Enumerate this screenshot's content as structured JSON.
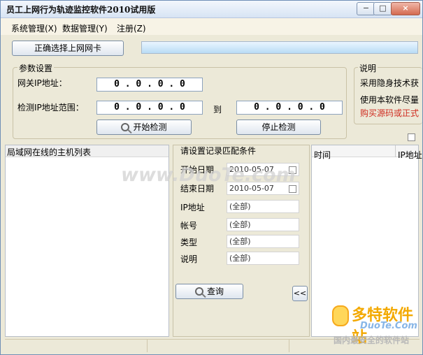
{
  "window": {
    "title": "员工上网行为轨迹监控软件2010试用版",
    "minimize": "−",
    "maximize": "□",
    "close": "×"
  },
  "menu": {
    "system": "系统管理(X)",
    "data": "数据管理(Y)",
    "register": "注册(Z)"
  },
  "toolbar": {
    "select_nic": "正确选择上网网卡"
  },
  "params": {
    "title": "参数设置",
    "gateway_label": "网关IP地址：",
    "gateway_ip": "0 . 0 . 0 . 0",
    "range_label": "检测IP地址范围：",
    "range_start": "0 . 0 . 0 . 0",
    "to_label": "到",
    "range_end": "0 . 0 . 0 . 0",
    "start_button": "开始检测",
    "stop_button": "停止检测"
  },
  "notes": {
    "title": "说明",
    "line1": "采用隐身技术获",
    "line2": "使用本软件尽量",
    "line3": "购买源码或正式"
  },
  "host_list": {
    "title": "局域网在线的主机列表"
  },
  "filter": {
    "title": "请设置记录匹配条件",
    "start_date_label": "开始日期",
    "start_date_value": "2010-05-07",
    "end_date_label": "结束日期",
    "end_date_value": "2010-05-07",
    "ip_label": "IP地址",
    "ip_value": "(全部)",
    "account_label": "帐号",
    "account_value": "(全部)",
    "type_label": "类型",
    "type_value": "(全部)",
    "desc_label": "说明",
    "desc_value": "(全部)",
    "query_button": "查询",
    "collapse_button": "<<"
  },
  "records": {
    "columns": [
      "时间",
      "IP地址"
    ]
  },
  "overlay": {
    "watermark": "www.DuoTe.com",
    "logo_cn": "多特软件站",
    "logo_en": "DuoTe.Com",
    "logo_foot": "国内最安全的软件站"
  }
}
